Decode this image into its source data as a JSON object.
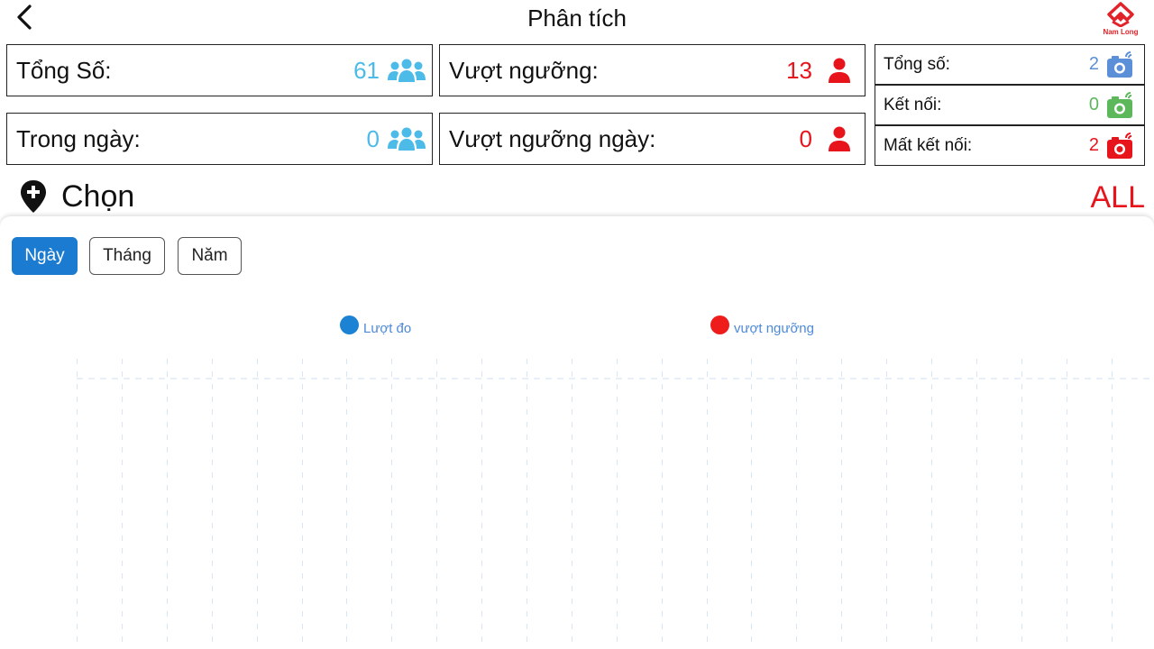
{
  "header": {
    "title": "Phân tích",
    "logo_text": "Nam Long"
  },
  "stats": {
    "total": {
      "label": "Tổng Số:",
      "value": "61"
    },
    "today": {
      "label": "Trong ngày:",
      "value": "0"
    },
    "over_threshold": {
      "label": "Vượt ngưỡng:",
      "value": "13"
    },
    "over_threshold_today": {
      "label": "Vượt ngưỡng ngày:",
      "value": "0"
    }
  },
  "cameras": {
    "total": {
      "label": "Tổng số:",
      "value": "2"
    },
    "connected": {
      "label": "Kết nối:",
      "value": "0"
    },
    "disconnected": {
      "label": "Mất kết nối:",
      "value": "2"
    }
  },
  "location": {
    "label": "Chọn",
    "filter": "ALL"
  },
  "tabs": [
    {
      "label": "Ngày",
      "active": true
    },
    {
      "label": "Tháng",
      "active": false
    },
    {
      "label": "Năm",
      "active": false
    }
  ],
  "colors": {
    "primary_blue": "#1b7bd0",
    "cyan": "#4dbbe8",
    "red": "#e8141b",
    "green": "#5db85c",
    "camera_blue": "#5b8fd8"
  },
  "chart_data": {
    "type": "line",
    "series": [
      {
        "name": "Lượt đo",
        "color": "#1b82d4",
        "values": []
      },
      {
        "name": "vượt ngưỡng",
        "color": "#ef1c1c",
        "values": []
      }
    ],
    "grid": true,
    "legend": "top-center"
  }
}
